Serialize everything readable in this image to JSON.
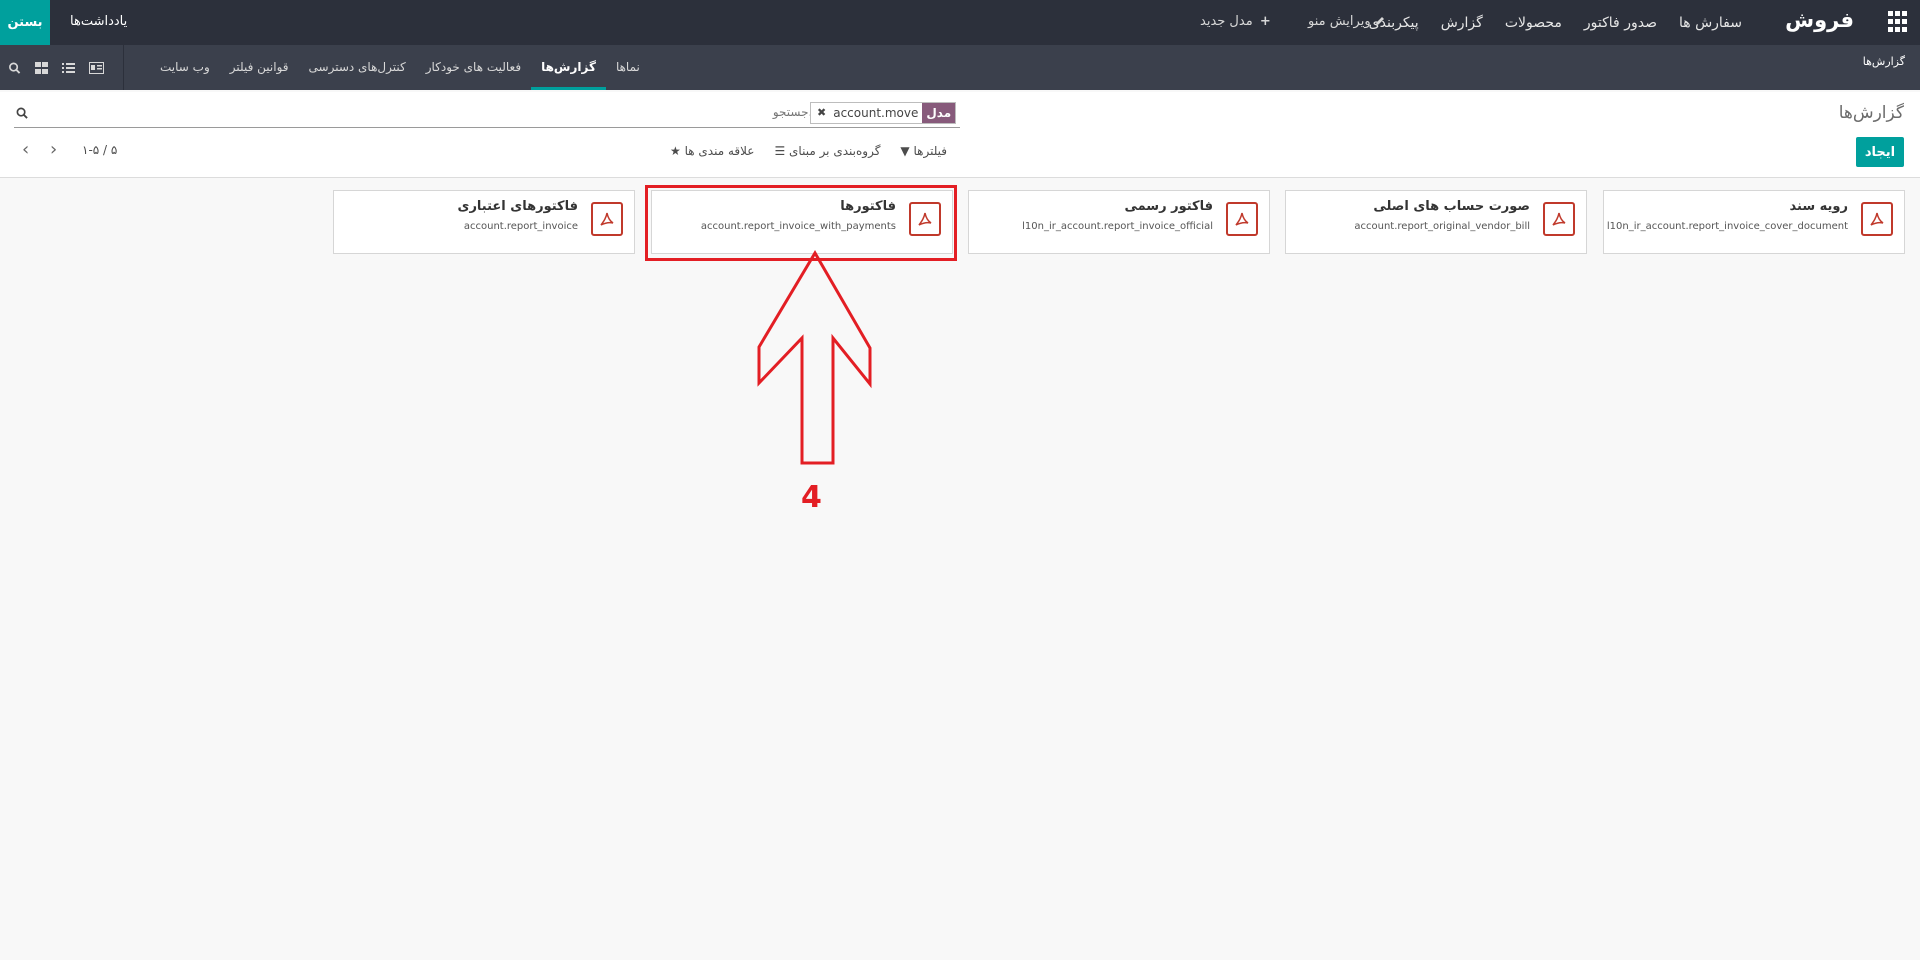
{
  "topbar": {
    "brand": "فروش",
    "menu": [
      {
        "label": "سفارش ها"
      },
      {
        "label": "صدور فاکتور"
      },
      {
        "label": "محصولات"
      },
      {
        "label": "گزارش"
      },
      {
        "label": "پیکربندی"
      }
    ],
    "edit_menu": "ویرایش منو",
    "new_model": "مدل جدید",
    "notes": "یادداشت‌ها",
    "close": "بستن"
  },
  "subbar": {
    "breadcrumb": "گزارش‌ها",
    "tabs": [
      {
        "label": "نماها"
      },
      {
        "label": "گزارش‌ها"
      },
      {
        "label": "فعالیت های خودکار"
      },
      {
        "label": "کنترل‌های دسترسی"
      },
      {
        "label": "قوانین فیلتر"
      },
      {
        "label": "وب سایت"
      }
    ]
  },
  "control": {
    "title": "گزارش‌ها",
    "create": "ایجاد",
    "facet_label": "مدل",
    "facet_value": "account.move",
    "search_placeholder": "جستجو...",
    "filters": "فیلترها",
    "group_by": "گروه‌بندی بر مبنای",
    "favorites": "علاقه مندی ها",
    "pager": "۱-۵ / ۵"
  },
  "cards": [
    {
      "title": "رویه سند",
      "subtitle": "l10n_ir_account.report_invoice_cover_document"
    },
    {
      "title": "صورت حساب های اصلی",
      "subtitle": "account.report_original_vendor_bill"
    },
    {
      "title": "فاکتور رسمی",
      "subtitle": "l10n_ir_account.report_invoice_official"
    },
    {
      "title": "فاکتورها",
      "subtitle": "account.report_invoice_with_payments"
    },
    {
      "title": "فاکتورهای اعتباری",
      "subtitle": "account.report_invoice"
    }
  ],
  "annotation": {
    "step": "4"
  },
  "colors": {
    "accent": "#00a09d",
    "facet": "#875a7b",
    "annotation": "#e31e24",
    "pdf": "#c0392b"
  }
}
